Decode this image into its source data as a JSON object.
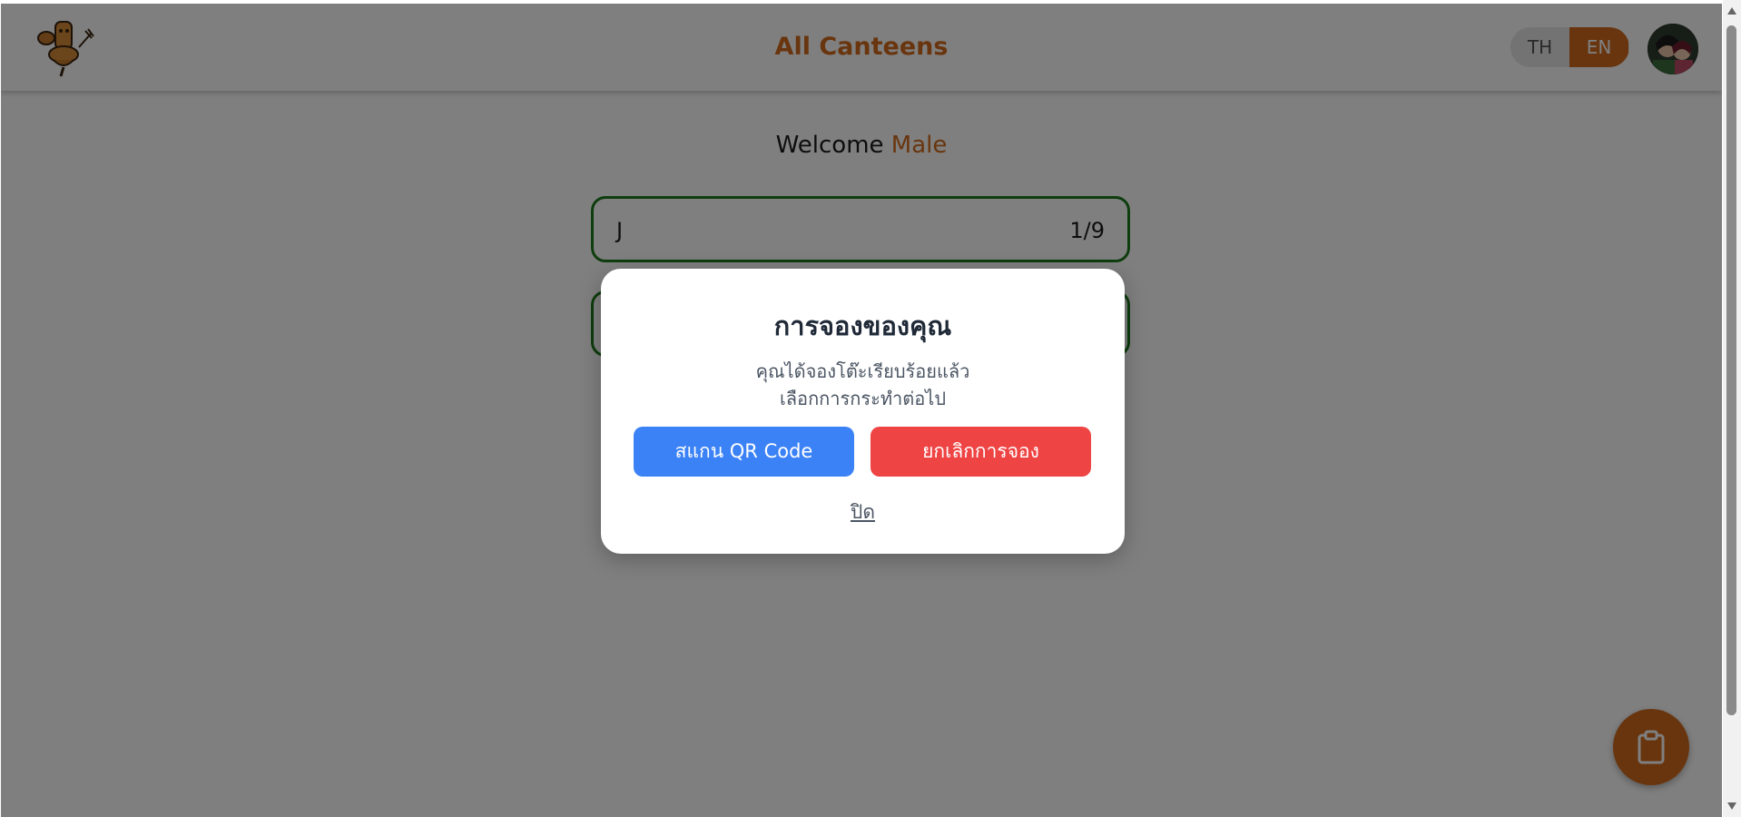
{
  "header": {
    "title": "All Canteens",
    "lang_th": "TH",
    "lang_en": "EN",
    "active_lang": "EN",
    "logo_icon": "mascot-logo-icon",
    "avatar_icon": "user-avatar"
  },
  "welcome": {
    "prefix": "Welcome",
    "name": "Male"
  },
  "canteens": [
    {
      "name": "J",
      "count": "1/9"
    }
  ],
  "modal": {
    "title": "การจองของคุณ",
    "line1": "คุณได้จองโต๊ะเรียบร้อยแล้ว",
    "line2": "เลือกการกระทำต่อไป",
    "scan_button": "สแกน QR Code",
    "cancel_button": "ยกเลิกการจอง",
    "close_link": "ปิด"
  },
  "fab": {
    "icon": "clipboard-icon"
  },
  "colors": {
    "accent": "#d26a1c",
    "card_border": "#1d7a1d",
    "scan_button": "#3b82f6",
    "cancel_button": "#ef4444"
  }
}
